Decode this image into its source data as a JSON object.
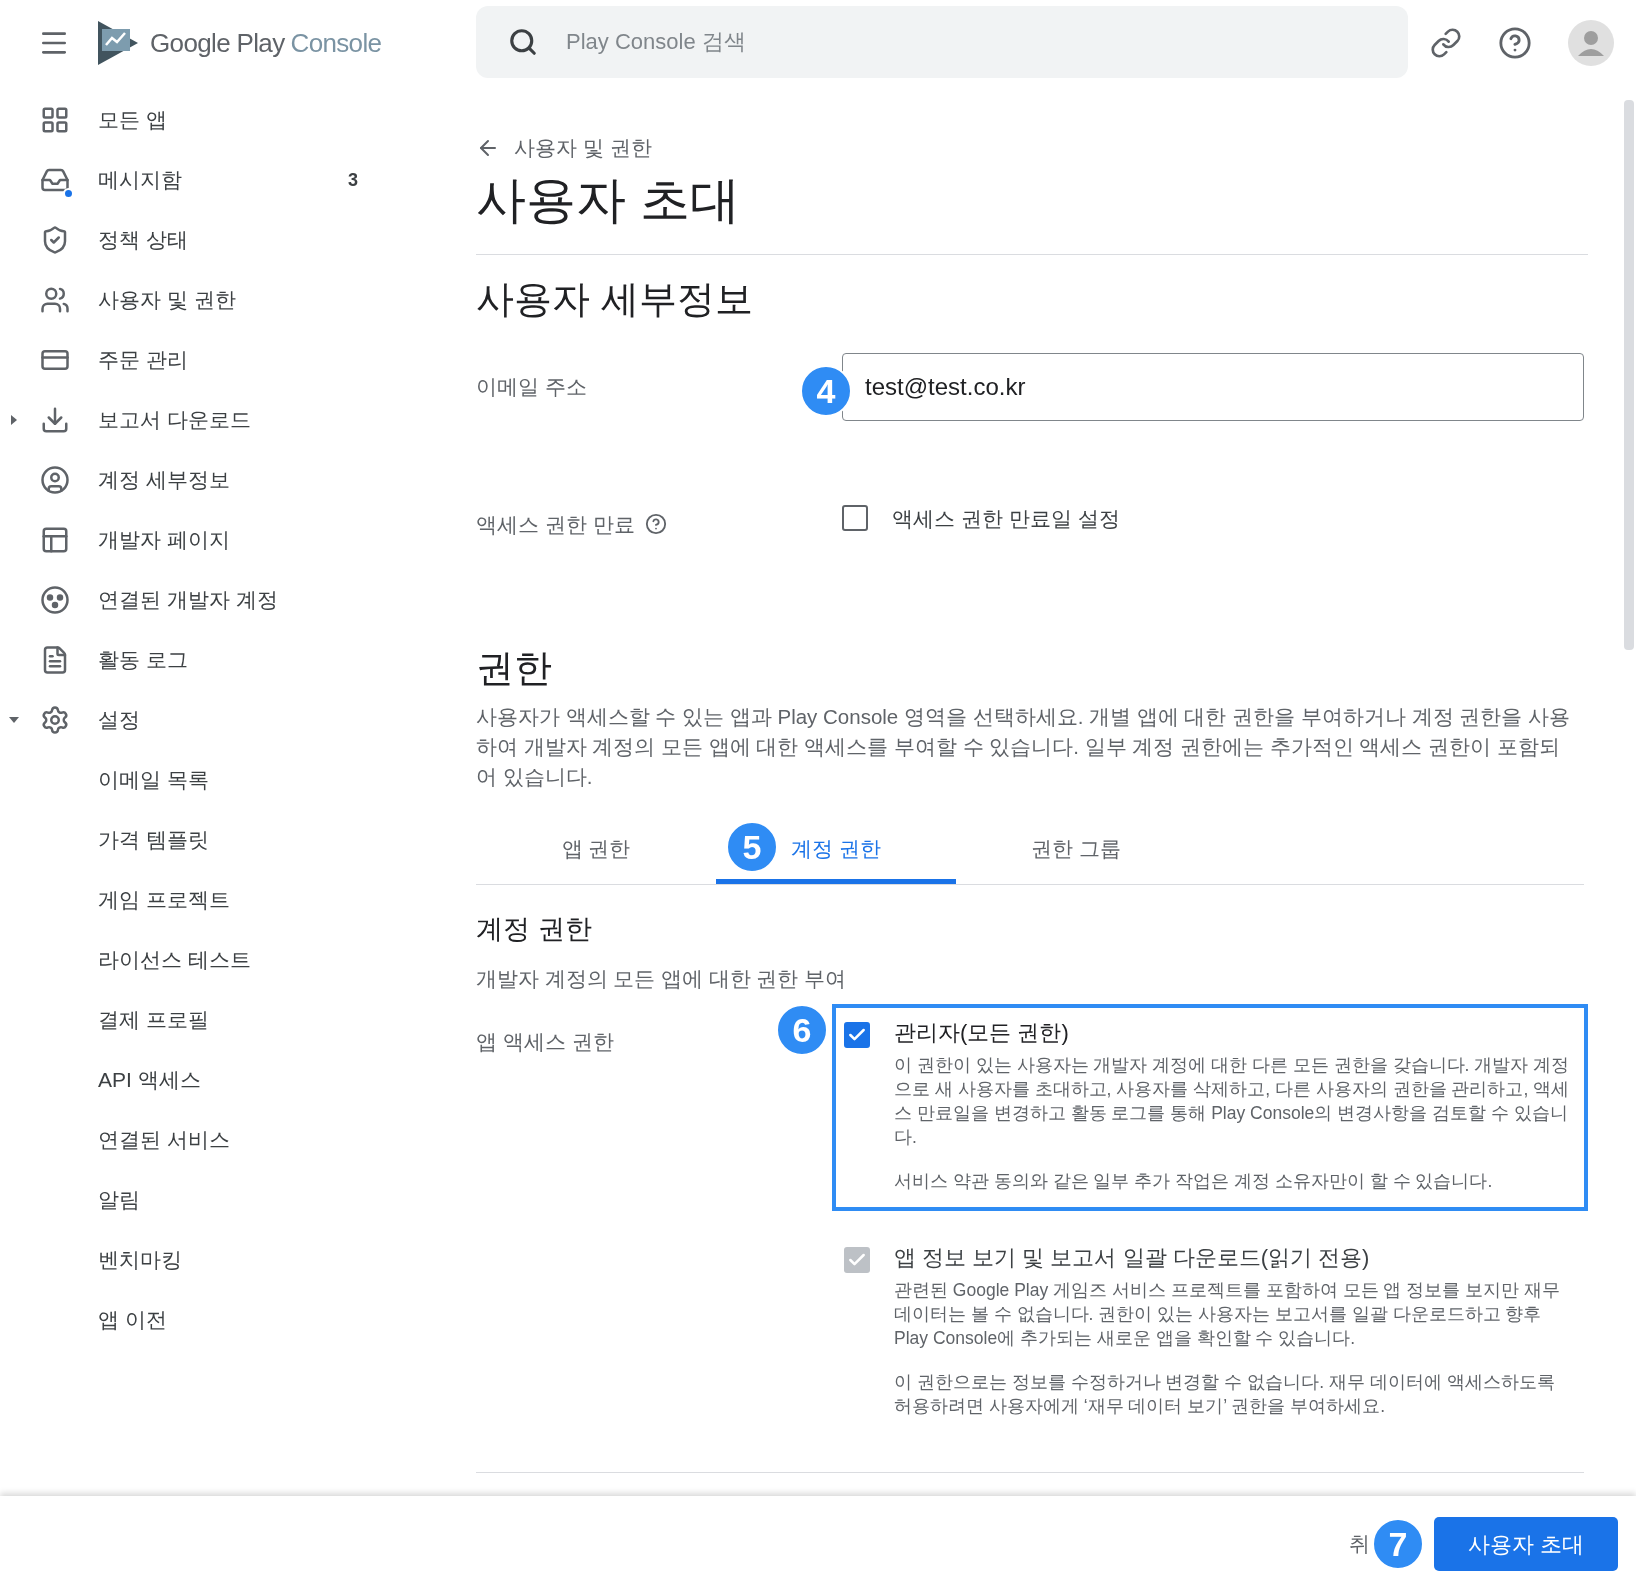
{
  "header": {
    "logo": {
      "primary": "Google Play",
      "secondary": "Console"
    },
    "search": {
      "placeholder": "Play Console 검색"
    }
  },
  "sidebar": {
    "items": [
      {
        "label": "모든 앱"
      },
      {
        "label": "메시지함",
        "count": "3",
        "unread": true
      },
      {
        "label": "정책 상태"
      },
      {
        "label": "사용자 및 권한"
      },
      {
        "label": "주문 관리"
      },
      {
        "label": "보고서 다운로드",
        "expanded": false
      },
      {
        "label": "계정 세부정보"
      },
      {
        "label": "개발자 페이지"
      },
      {
        "label": "연결된 개발자 계정"
      },
      {
        "label": "활동 로그"
      },
      {
        "label": "설정",
        "expanded": true,
        "children": [
          {
            "label": "이메일 목록"
          },
          {
            "label": "가격 템플릿"
          },
          {
            "label": "게임 프로젝트"
          },
          {
            "label": "라이선스 테스트"
          },
          {
            "label": "결제 프로필"
          },
          {
            "label": "API 액세스"
          },
          {
            "label": "연결된 서비스"
          },
          {
            "label": "알림"
          },
          {
            "label": "벤치마킹"
          },
          {
            "label": "앱 이전"
          }
        ]
      }
    ]
  },
  "page": {
    "back_link": "사용자 및 권한",
    "title": "사용자 초대",
    "details": {
      "heading": "사용자 세부정보",
      "email": {
        "label": "이메일 주소",
        "value": "test@test.co.kr",
        "callout": "4"
      },
      "expiry": {
        "label": "액세스 권한 만료",
        "checkbox": {
          "label": "액세스 권한 만료일 설정",
          "checked": false
        }
      }
    },
    "permissions": {
      "heading": "권한",
      "description": "사용자가 액세스할 수 있는 앱과 Play Console 영역을 선택하세요. 개별 앱에 대한 권한을 부여하거나 계정 권한을 사용하여 개발자 계정의 모든 앱에 대한 액세스를 부여할 수 있습니다. 일부 계정 권한에는 추가적인 액세스 권한이 포함되어 있습니다.",
      "tabs": [
        {
          "label": "앱 권한",
          "selected": false
        },
        {
          "label": "계정 권한",
          "selected": true,
          "callout": "5"
        },
        {
          "label": "권한 그룹",
          "selected": false
        }
      ],
      "section_heading": "계정 권한",
      "section_subtitle": "개발자 계정의 모든 앱에 대한 권한 부여",
      "group_label": "앱 액세스 권한",
      "options": [
        {
          "title": "관리자(모든 권한)",
          "checked": true,
          "disabled": false,
          "highlighted": true,
          "callout": "6",
          "paragraphs": [
            "이 권한이 있는 사용자는 개발자 계정에 대한 다른 모든 권한을 갖습니다. 개발자 계정으로 새 사용자를 초대하고, 사용자를 삭제하고, 다른 사용자의 권한을 관리하고, 액세스 만료일을 변경하고 활동 로그를 통해 Play Console의 변경사항을 검토할 수 있습니다.",
            "서비스 약관 동의와 같은 일부 추가 작업은 계정 소유자만이 할 수 있습니다."
          ]
        },
        {
          "title": "앱 정보 보기 및 보고서 일괄 다운로드(읽기 전용)",
          "checked": true,
          "disabled": true,
          "paragraphs": [
            "관련된 Google Play 게임즈 서비스 프로젝트를 포함하여 모든 앱 정보를 보지만 재무 데이터는 볼 수 없습니다. 권한이 있는 사용자는 보고서를 일괄 다운로드하고 향후 Play Console에 추가되는 새로운 앱을 확인할 수 있습니다.",
            "이 권한으로는 정보를 수정하거나 변경할 수 없습니다. 재무 데이터에 액세스하도록 허용하려면 사용자에게 ‘재무 데이터 보기’ 권한을 부여하세요."
          ]
        }
      ]
    }
  },
  "footer": {
    "cancel": "취",
    "callout": "7",
    "primary": "사용자 초대"
  }
}
